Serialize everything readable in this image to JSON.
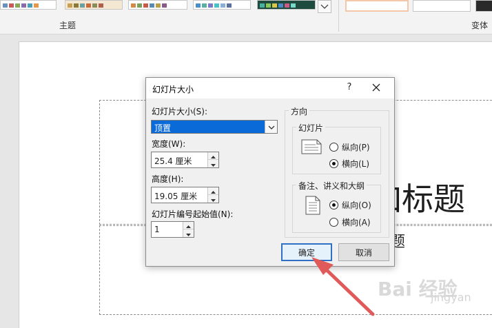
{
  "ribbon": {
    "themes_group_label": "主题",
    "variants_group_label": "变体",
    "more_icon": "chevron-down-icon"
  },
  "slide": {
    "title_text": "加标题",
    "subtitle_text": "题"
  },
  "dialog": {
    "title": "幻灯片大小",
    "help_label": "?",
    "size_label": "幻灯片大小(S):",
    "size_value": "顶置",
    "width_label": "宽度(W):",
    "width_value": "25.4 厘米",
    "height_label": "高度(H):",
    "height_value": "19.05 厘米",
    "numbering_label": "幻灯片编号起始值(N):",
    "numbering_value": "1",
    "orientation_label": "方向",
    "slides_group": {
      "label": "幻灯片",
      "portrait_label": "纵向(P)",
      "landscape_label": "横向(L)",
      "selected": "landscape"
    },
    "notes_group": {
      "label": "备注、讲义和大纲",
      "portrait_label": "纵向(O)",
      "landscape_label": "横向(A)",
      "selected": "portrait"
    },
    "ok_label": "确定",
    "cancel_label": "取消"
  },
  "watermark": {
    "text": "Bai 经验",
    "subtext": "jingyan"
  },
  "colors": {
    "selection_blue": "#0a6ad8",
    "default_button_border": "#2f6fc4",
    "annotation_arrow": "#e05a5a"
  }
}
